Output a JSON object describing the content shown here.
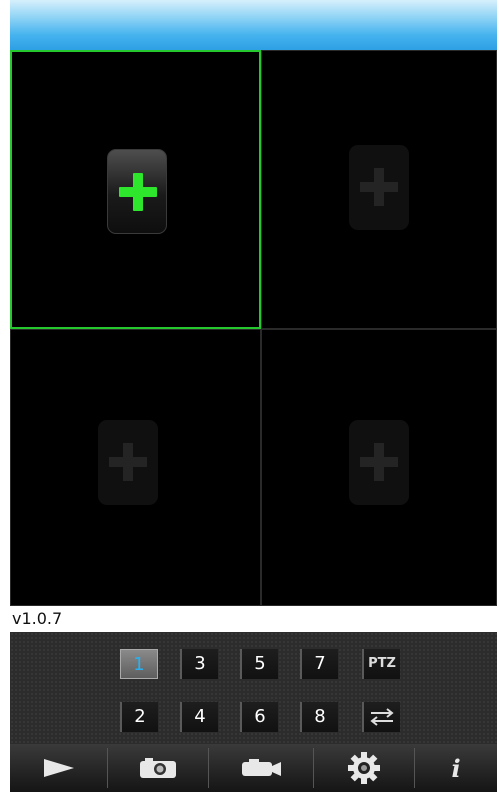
{
  "version_text": "v1.0.7",
  "channels": {
    "row1": [
      "1",
      "3",
      "5",
      "7",
      "PTZ"
    ],
    "row2": [
      "2",
      "4",
      "6",
      "8"
    ],
    "selected": "1"
  },
  "colors": {
    "accent_green": "#25c92d",
    "channel_active_text": "#29b0f0",
    "title_bar_blue": "#46b3ee"
  },
  "toolbar_icons": [
    "play-icon",
    "camera-icon",
    "video-camera-icon",
    "gear-icon",
    "info-icon"
  ],
  "toolbar_info_label": "i"
}
